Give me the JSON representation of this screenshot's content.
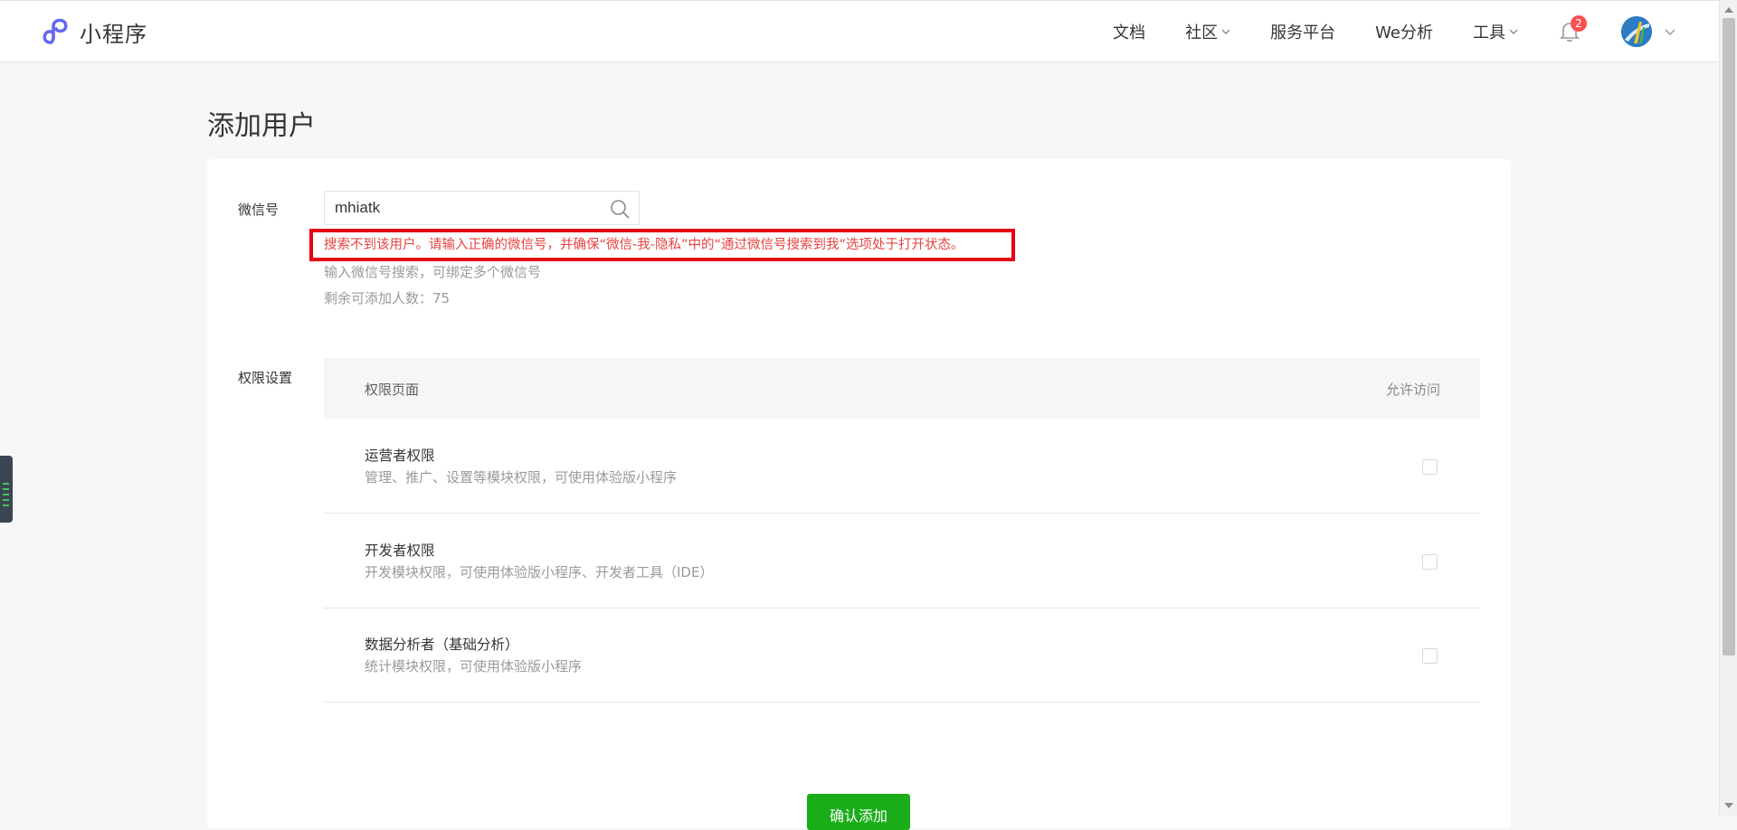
{
  "header": {
    "brand": "小程序",
    "nav": [
      {
        "label": "文档"
      },
      {
        "label": "社区"
      },
      {
        "label": "服务平台"
      },
      {
        "label": "We分析"
      },
      {
        "label": "工具"
      }
    ],
    "notification_count": "2"
  },
  "page": {
    "title": "添加用户"
  },
  "form": {
    "wechat_label": "微信号",
    "search_value": "mhiatk",
    "error_message": "搜索不到该用户。请输入正确的微信号，并确保“微信-我-隐私”中的“通过微信号搜索到我”选项处于打开状态。",
    "hint": "输入微信号搜索，可绑定多个微信号",
    "remaining": "剩余可添加人数：75",
    "permission_label": "权限设置"
  },
  "table": {
    "col_page": "权限页面",
    "col_allow": "允许访问",
    "rows": [
      {
        "title": "运营者权限",
        "desc": "管理、推广、设置等模块权限，可使用体验版小程序"
      },
      {
        "title": "开发者权限",
        "desc": "开发模块权限，可使用体验版小程序、开发者工具（IDE）"
      },
      {
        "title": "数据分析者（基础分析）",
        "desc": "统计模块权限，可使用体验版小程序"
      }
    ]
  },
  "actions": {
    "confirm": "确认添加"
  },
  "colors": {
    "brand_green": "#1aad19",
    "error_red": "#e64340",
    "highlight_border": "#e60012",
    "badge_red": "#fa5151"
  }
}
